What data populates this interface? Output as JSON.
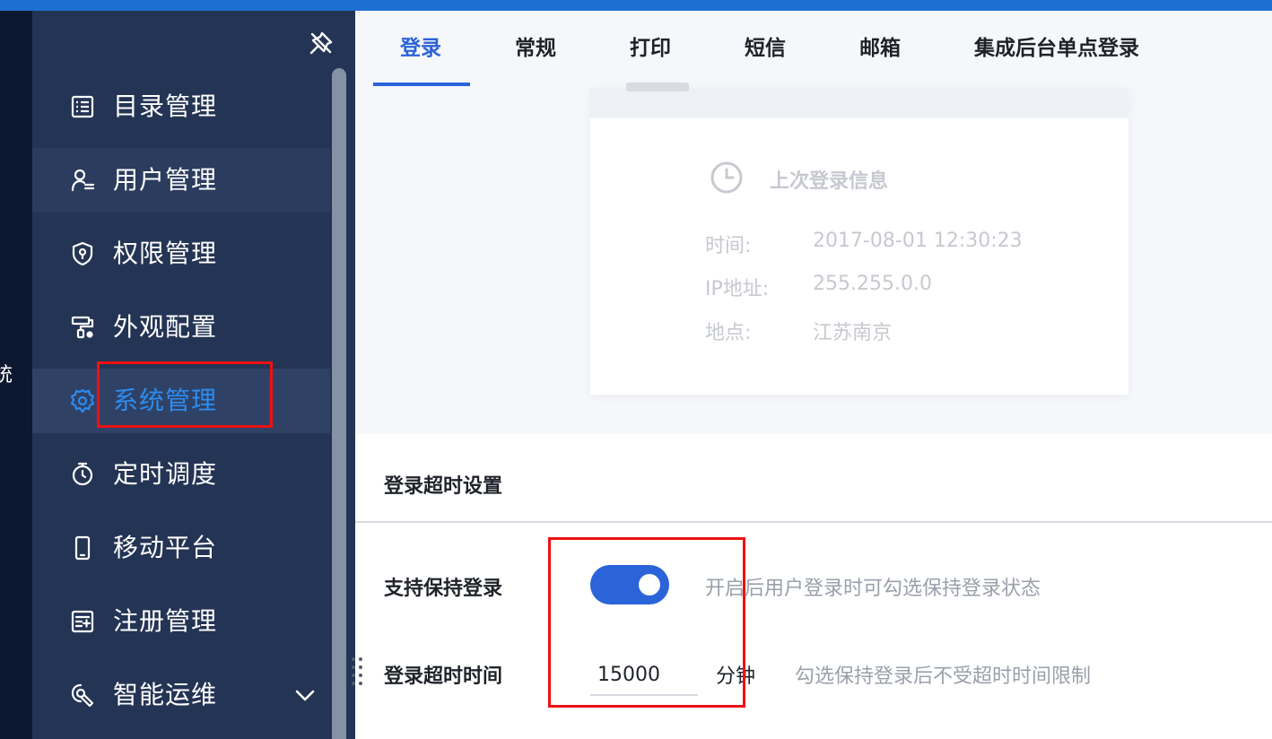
{
  "brand_fragment": "统",
  "sidebar": {
    "items": [
      {
        "label": "目录管理",
        "icon": "list-icon"
      },
      {
        "label": "用户管理",
        "icon": "user-list-icon"
      },
      {
        "label": "权限管理",
        "icon": "shield-icon"
      },
      {
        "label": "外观配置",
        "icon": "paint-roller-icon"
      },
      {
        "label": "系统管理",
        "icon": "gear-icon",
        "active": true
      },
      {
        "label": "定时调度",
        "icon": "stopwatch-icon"
      },
      {
        "label": "移动平台",
        "icon": "mobile-icon"
      },
      {
        "label": "注册管理",
        "icon": "register-form-icon"
      },
      {
        "label": "智能运维",
        "icon": "ops-icon",
        "expandable": true
      }
    ]
  },
  "tabs": [
    "登录",
    "常规",
    "打印",
    "短信",
    "邮箱",
    "集成后台单点登录"
  ],
  "active_tab": "登录",
  "last_login": {
    "title": "上次登录信息",
    "time_label": "时间:",
    "time_value": "2017-08-01 12:30:23",
    "ip_label": "IP地址:",
    "ip_value": "255.255.0.0",
    "location_label": "地点:",
    "location_value": "江苏南京"
  },
  "timeout_settings": {
    "title": "登录超时设置",
    "keep_login_label": "支持保持登录",
    "keep_login_enabled": true,
    "keep_login_hint": "开启后用户登录时可勾选保持登录状态",
    "timeout_label": "登录超时时间",
    "timeout_value": "15000",
    "timeout_unit": "分钟",
    "timeout_hint": "勾选保持登录后不受超时时间限制"
  },
  "colors": {
    "accent": "#2b63d9",
    "sidebar_bg": "#243454",
    "active_text": "#2d8cf0",
    "annotation": "#ee1111"
  }
}
